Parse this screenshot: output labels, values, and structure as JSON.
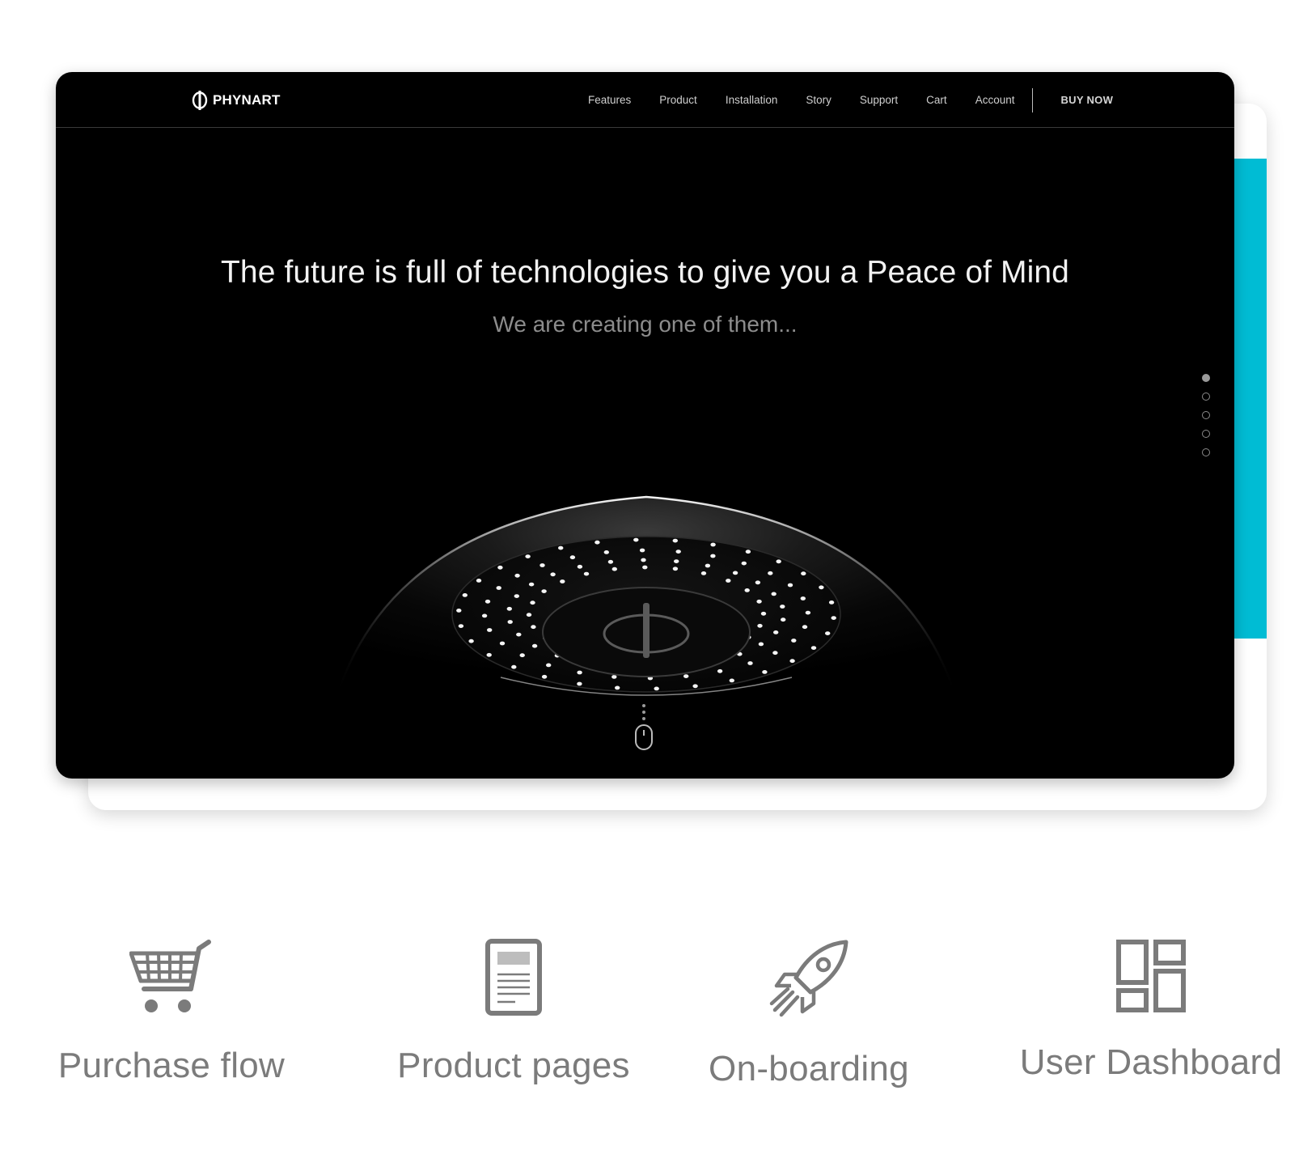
{
  "brand": {
    "name": "PHYNART"
  },
  "nav": {
    "items": [
      "Features",
      "Product",
      "Installation",
      "Story",
      "Support",
      "Cart",
      "Account"
    ],
    "cta": "BUY NOW"
  },
  "hero": {
    "title": "The future is full of technologies to give you a Peace of Mind",
    "subtitle": "We are creating one of them...",
    "active_slide": 1,
    "slide_count": 5
  },
  "features": [
    {
      "label": "Purchase flow",
      "icon": "shopping-cart-icon"
    },
    {
      "label": "Product pages",
      "icon": "document-page-icon"
    },
    {
      "label": "On-boarding",
      "icon": "rocket-icon"
    },
    {
      "label": "User Dashboard",
      "icon": "dashboard-grid-icon"
    }
  ],
  "colors": {
    "accent": "#00bcd4",
    "screen_bg": "#000000",
    "icon_gray": "#7b7b7b"
  }
}
